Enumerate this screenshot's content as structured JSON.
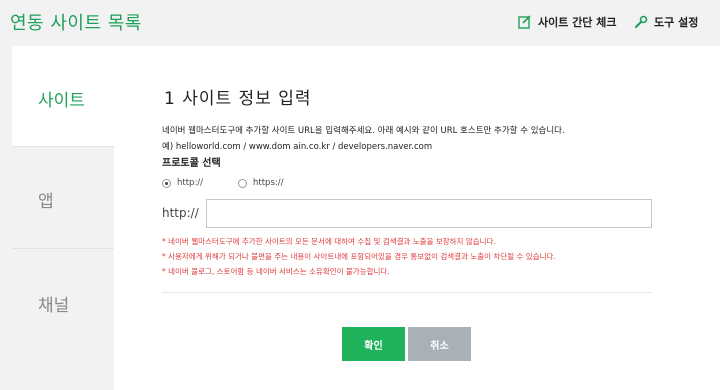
{
  "header": {
    "title": "연동 사이트 목록",
    "site_check_label": "사이트 간단 체크",
    "tools_label": "도구 설정"
  },
  "sidebar": {
    "items": [
      {
        "label": "사이트",
        "active": true
      },
      {
        "label": "앱",
        "active": false
      },
      {
        "label": "채널",
        "active": false
      }
    ]
  },
  "form": {
    "heading": "1 사이트 정보 입력",
    "description": "네이버 웹마스터도구에 추가할 사이트 URL을 입력해주세요. 아래 예시와 같이 URL 호스트만 추가할 수 있습니다.",
    "example": "예) helloworld.com  / www.dom ain.co.kr / developers.naver.com",
    "protocol_label": "프로토콜 선택",
    "protocol_options": [
      {
        "label": "http://",
        "selected": true
      },
      {
        "label": "https://",
        "selected": false
      }
    ],
    "url_prefix": "http://",
    "url_value": "",
    "notes": [
      "* 네이버 웹마스터도구에 추가한 사이트의 모든 문서에 대하여 수집 및 검색결과 노출을 보장하지 않습니다.",
      "* 사용자에게 위해가 되거나 불편을 주는 내용이 사이트내에 포함되어있을 경우 통보없이 검색결과 노출이 차단될 수 있습니다.",
      "* 네이버 블로그, 스토어팜 등 네이버 서비스는 소유확인이 불가능합니다."
    ],
    "confirm_label": "확인",
    "cancel_label": "취소"
  },
  "colors": {
    "accent": "#1fa05b",
    "confirm_button": "#1fb25a",
    "cancel_button": "#a9b1b8",
    "note_text": "#e03b3b"
  },
  "icons": {
    "site_check": "edit-check-icon",
    "tools": "wrench-icon"
  }
}
